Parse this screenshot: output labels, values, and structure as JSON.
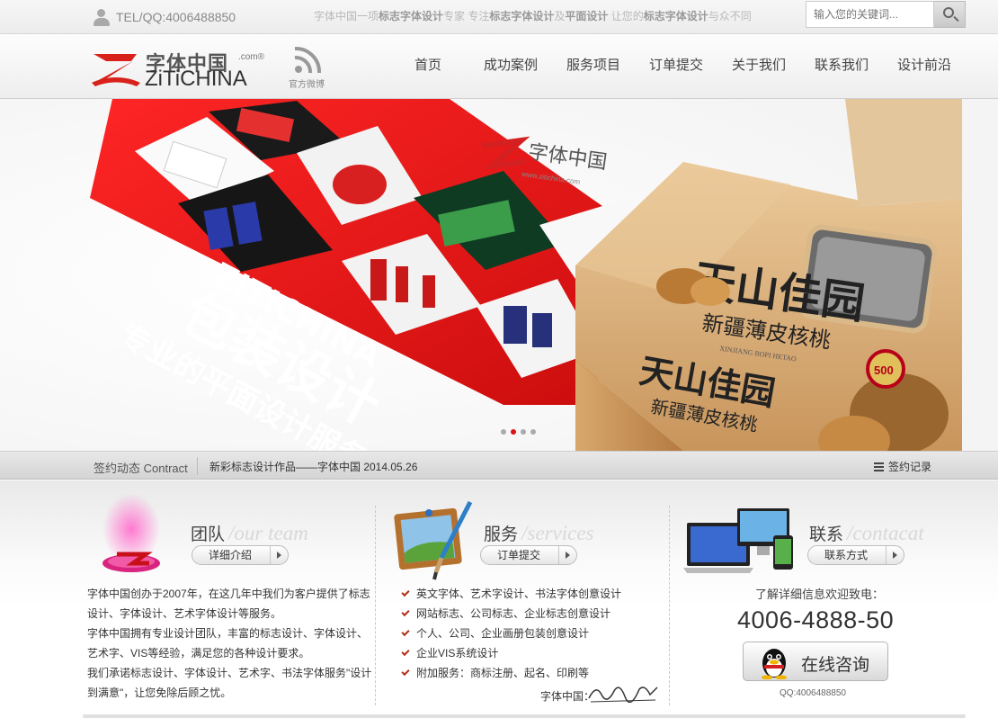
{
  "topbar": {
    "tel": "TEL/QQ:4006488850",
    "slogan_parts": [
      {
        "t": "字体中国一项",
        "b": false
      },
      {
        "t": "标志字体设计",
        "b": true
      },
      {
        "t": "专家  专注",
        "b": false
      },
      {
        "t": "标志字体设计",
        "b": true
      },
      {
        "t": "及",
        "b": false
      },
      {
        "t": "平面设计",
        "b": true
      },
      {
        "t": "  让您的",
        "b": false
      },
      {
        "t": "标志字体设计",
        "b": true
      },
      {
        "t": "与众不同",
        "b": false
      }
    ],
    "search_placeholder": "输入您的关键词..."
  },
  "header": {
    "logo_cn": "字体中国",
    "logo_com": ".com®",
    "logo_en": "ZiTiCHINA",
    "weibo_label": "官方微博",
    "nav": [
      "首页",
      "成功案例",
      "服务项目",
      "订单提交",
      "关于我们",
      "联系我们",
      "设计前沿"
    ]
  },
  "banner": {
    "big_text_en": "ZITICHINA",
    "big_text_1": "包装设计",
    "big_text_2": "专业的平面设计服务团队",
    "brand_mark": "字体中国",
    "brand_url": "www.zitichina.com",
    "product_title": "天山佳园",
    "product_subtitle": "新疆薄皮核桃",
    "product_pinyin": "XINJIANG BOPI HETAO",
    "product_badge": "500",
    "slides": 4,
    "active_slide": 1
  },
  "contract": {
    "label": "签约动态 Contract",
    "news": "新彩标志设计作品——字体中国 2014.05.26",
    "record": "签约记录"
  },
  "team": {
    "title": "团队",
    "title_en": "/our team",
    "button": "详细介绍",
    "paragraphs": [
      "字体中国创办于2007年，在这几年中我们为客户提供了标志设计、字体设计、艺术字体设计等服务。",
      "字体中国拥有专业设计团队，丰富的标志设计、字体设计、艺术字、VIS等经验，满足您的各种设计要求。",
      "我们承诺标志设计、字体设计、艺术字、书法字体服务\"设计到满意\"，让您免除后顾之忧。"
    ]
  },
  "services": {
    "title": "服务",
    "title_en": "/services",
    "button": "订单提交",
    "items": [
      "英文字体、艺术字设计、书法字体创意设计",
      "网站标志、公司标志、企业标志创意设计",
      "个人、公司、企业画册包装创意设计",
      "企业VIS系统设计",
      "附加服务：商标注册、起名、印刷等"
    ],
    "signature_label": "字体中国："
  },
  "contact": {
    "title": "联系",
    "title_en": "/contacat",
    "button": "联系方式",
    "intro": "了解详细信息欢迎致电：",
    "phone": "4006-4888-50",
    "consult": "在线咨询",
    "qq": "QQ:4006488850"
  }
}
